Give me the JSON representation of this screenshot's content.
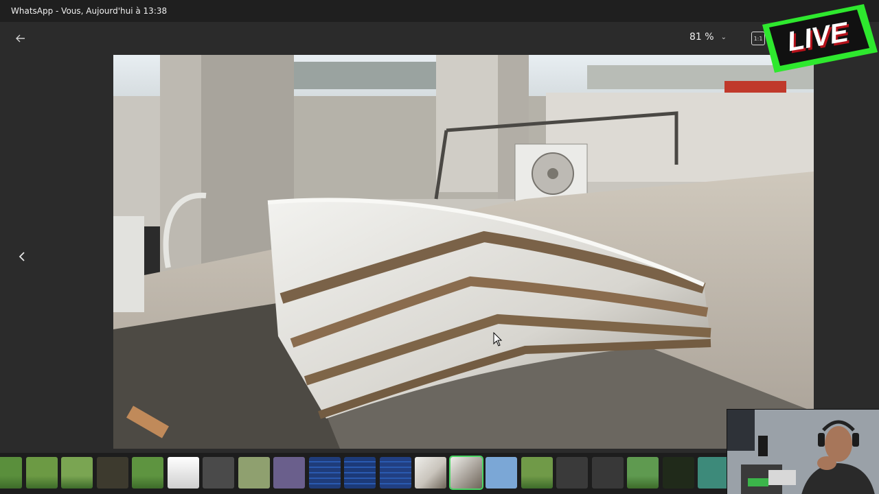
{
  "window": {
    "title": "WhatsApp - Vous, Aujourd'hui à 13:38"
  },
  "toolbar": {
    "zoom_level": "81 %",
    "back_icon": "arrow-left-icon",
    "zoom_icon": "chevron-down-icon",
    "ratio_icon": "actual-size-icon"
  },
  "viewer": {
    "prev_icon": "chevron-left-icon",
    "photo_subject": "rooftop-satellite-dish-image"
  },
  "overlay": {
    "live_label": "LIVE",
    "live_colors": {
      "primary": "#2ee82e",
      "text": "#ffffff",
      "shadow": "#b5121b",
      "panel": "#111111"
    }
  },
  "filmstrip": {
    "selected_index": 13,
    "thumbs": [
      {
        "kind": "field",
        "color": "#5a8f3c"
      },
      {
        "kind": "field",
        "color": "#6c9a44"
      },
      {
        "kind": "field",
        "color": "#7aa552"
      },
      {
        "kind": "dark",
        "color": "#3d3a2e"
      },
      {
        "kind": "field",
        "color": "#5e9440"
      },
      {
        "kind": "doc",
        "color": "#cfcfcf"
      },
      {
        "kind": "dark",
        "color": "#4a4a4a"
      },
      {
        "kind": "outdoor",
        "color": "#8fa06f"
      },
      {
        "kind": "person",
        "color": "#6a5f8c"
      },
      {
        "kind": "table",
        "color": "#1f3c7a"
      },
      {
        "kind": "table",
        "color": "#1c3a78"
      },
      {
        "kind": "table",
        "color": "#213f82"
      },
      {
        "kind": "dish",
        "color": "#c9c4bc"
      },
      {
        "kind": "dish",
        "color": "#a8a29a"
      },
      {
        "kind": "sky",
        "color": "#7ba7d6"
      },
      {
        "kind": "field",
        "color": "#709a48"
      },
      {
        "kind": "dim",
        "color": "#3a3a3a"
      },
      {
        "kind": "dim",
        "color": "#383838"
      },
      {
        "kind": "field",
        "color": "#5f9a50"
      },
      {
        "kind": "screen",
        "color": "#202a1a"
      },
      {
        "kind": "outdoor",
        "color": "#3d8a7a"
      }
    ]
  }
}
